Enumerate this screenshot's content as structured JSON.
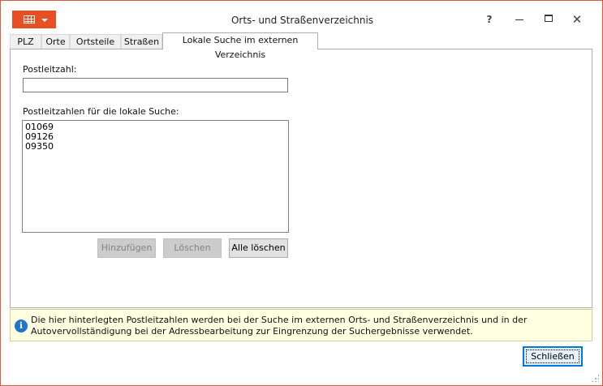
{
  "window": {
    "title": "Orts- und Straßenverzeichnis",
    "accent_color": "#ea4f23",
    "border_color": "#e05a3a"
  },
  "titlebar": {
    "app_menu_icon": "table-grid-icon",
    "help": "?",
    "close": "✕"
  },
  "tabs": [
    {
      "label": "PLZ",
      "active": false
    },
    {
      "label": "Orte",
      "active": false
    },
    {
      "label": "Ortsteile",
      "active": false
    },
    {
      "label": "Straßen",
      "active": false
    },
    {
      "label": "Lokale Suche im externen Verzeichnis",
      "active": true
    }
  ],
  "form": {
    "plz_label": "Postleitzahl:",
    "plz_value": "",
    "list_label": "Postleitzahlen für die lokale Suche:",
    "list_items": [
      "01069",
      "09126",
      "09350"
    ]
  },
  "buttons": {
    "add_label": "Hinzufügen",
    "delete_label": "Löschen",
    "delete_all_label": "Alle löschen",
    "close_label": "Schließen"
  },
  "info": {
    "icon": "info-icon",
    "text": "Die hier hinterlegten Postleitzahlen werden bei der Suche im externen Orts- und Straßenverzeichnis und in der Autovervollständigung bei der Adressbearbeitung zur Eingrenzung der Suchergebnisse verwendet."
  }
}
